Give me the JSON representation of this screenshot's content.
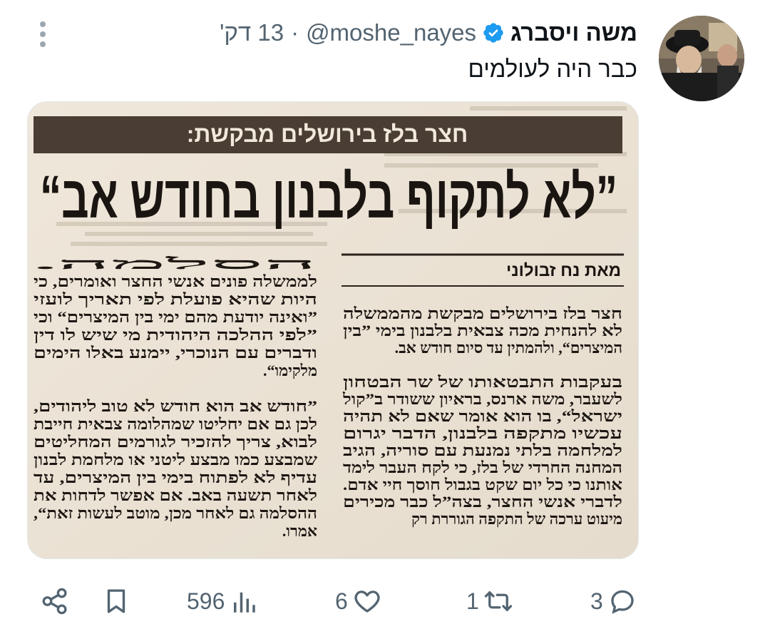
{
  "tweet": {
    "author_name": "משה ויסברג",
    "handle": "@moshe_nayes",
    "separator": "·",
    "time": "13 דק'",
    "text": "כבר היה לעולמים",
    "avatar_icon": "user-photo",
    "verified_color": "#1d9bf0"
  },
  "clipping": {
    "banner": "חצר בלז בירושלים מבקשת:",
    "headline": "”לא לתקוף בלבנון בחודש אב“",
    "byline": "מאת נח זבולוני",
    "right_column": [
      "חצר בלז בירושלים מבקשת מהממשלה",
      "לא להנחית מכה צבאית בלבנון בימי ”בין",
      "המיצרים“, ולהמתין עד סיום חודש אב.",
      "",
      "בעקבות התבטאותו של שר הבטחון",
      "לשעבר, משה ארנס, בראיון ששודר ב”קול",
      "ישראל“, בו הוא אומר שאם לא תהיה",
      "עכשיו מתקפה בלבנון, הדבר יגרום",
      "למלחמה בלתי נמנעת עם סוריה, הגיב",
      "המחנה החרדי של בלז, כי לקח העבר לימד",
      "אותנו כי כל יום שקט בגבול חוסך חיי אדם.",
      "לדברי אנשי החצר, בצה”ל כבר מכירים",
      "מיעוט ערכה של התקפה הגוררת רק"
    ],
    "left_column": [
      "הסלמה.",
      "לממשלה פונים אנשי החצר ואומרים, כי",
      "היות שהיא פועלת לפי תאריך לועזי",
      "”ואינה יודעת מהם ימי בין המיצרים“ וכי",
      "”לפי ההלכה היהודית מי שיש לו דין",
      "ודברים עם הנוכרי, יימנע באלו הימים",
      "מלקימו“.",
      "",
      "”חודש אב הוא חודש לא טוב ליהודים,",
      "לכן גם אם יחליטו שמהלומה צבאית חייבת",
      "לבוא, צריך להזכיר לגורמים המחליטים",
      "שמבצע כמו מבצע ליטני או מלחמת לבנון",
      "עדיף לא לפתוח בימי בין המיצרים, עד",
      "לאחר תשעה באב. אם אפשר לדחות את",
      "ההסלמה גם לאחר מכן, מוטב לעשות זאת“,",
      "אמרו."
    ]
  },
  "actions": {
    "replies": "3",
    "retweets": "1",
    "likes": "6",
    "views": "596"
  }
}
